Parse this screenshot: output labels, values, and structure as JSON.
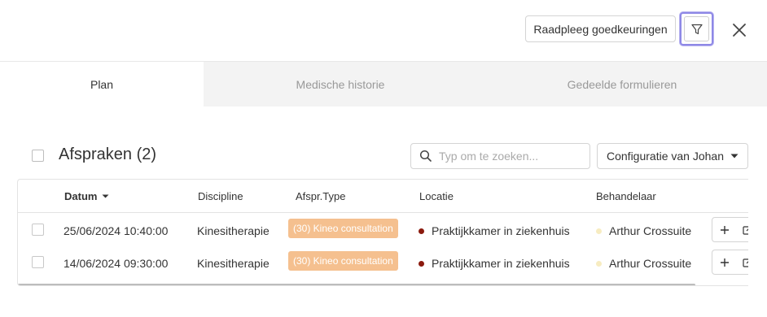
{
  "toolbar": {
    "consult_label": "Raadpleeg goedkeuringen",
    "filter_icon": "filter-icon",
    "close_icon": "close-icon"
  },
  "tabs": [
    {
      "label": "Plan",
      "active": true
    },
    {
      "label": "Medische historie",
      "active": false
    },
    {
      "label": "Gedeelde formulieren",
      "active": false
    }
  ],
  "section": {
    "title": "Afspraken (2)"
  },
  "search": {
    "placeholder": "Typ om te zoeken...",
    "value": ""
  },
  "config": {
    "label": "Configuratie van Johan"
  },
  "table": {
    "columns": [
      "Datum",
      "Discipline",
      "Afspr.Type",
      "Locatie",
      "Behandelaar"
    ],
    "rows": [
      {
        "datum": "25/06/2024 10:40:00",
        "discipline": "Kinesitherapie",
        "type": "(30) Kineo consultation",
        "locatie": "Praktijkkamer in ziekenhuis",
        "behandelaar": "Arthur Crossuite"
      },
      {
        "datum": "14/06/2024 09:30:00",
        "discipline": "Kinesitherapie",
        "type": "(30) Kineo consultation",
        "locatie": "Praktijkkamer in ziekenhuis",
        "behandelaar": "Arthur Crossuite"
      }
    ]
  },
  "colors": {
    "badge": "#f5c08f",
    "location_dot": "#8b1a0e",
    "practitioner_dot": "#f7ecc1",
    "filter_focus": "#8e88e6"
  }
}
